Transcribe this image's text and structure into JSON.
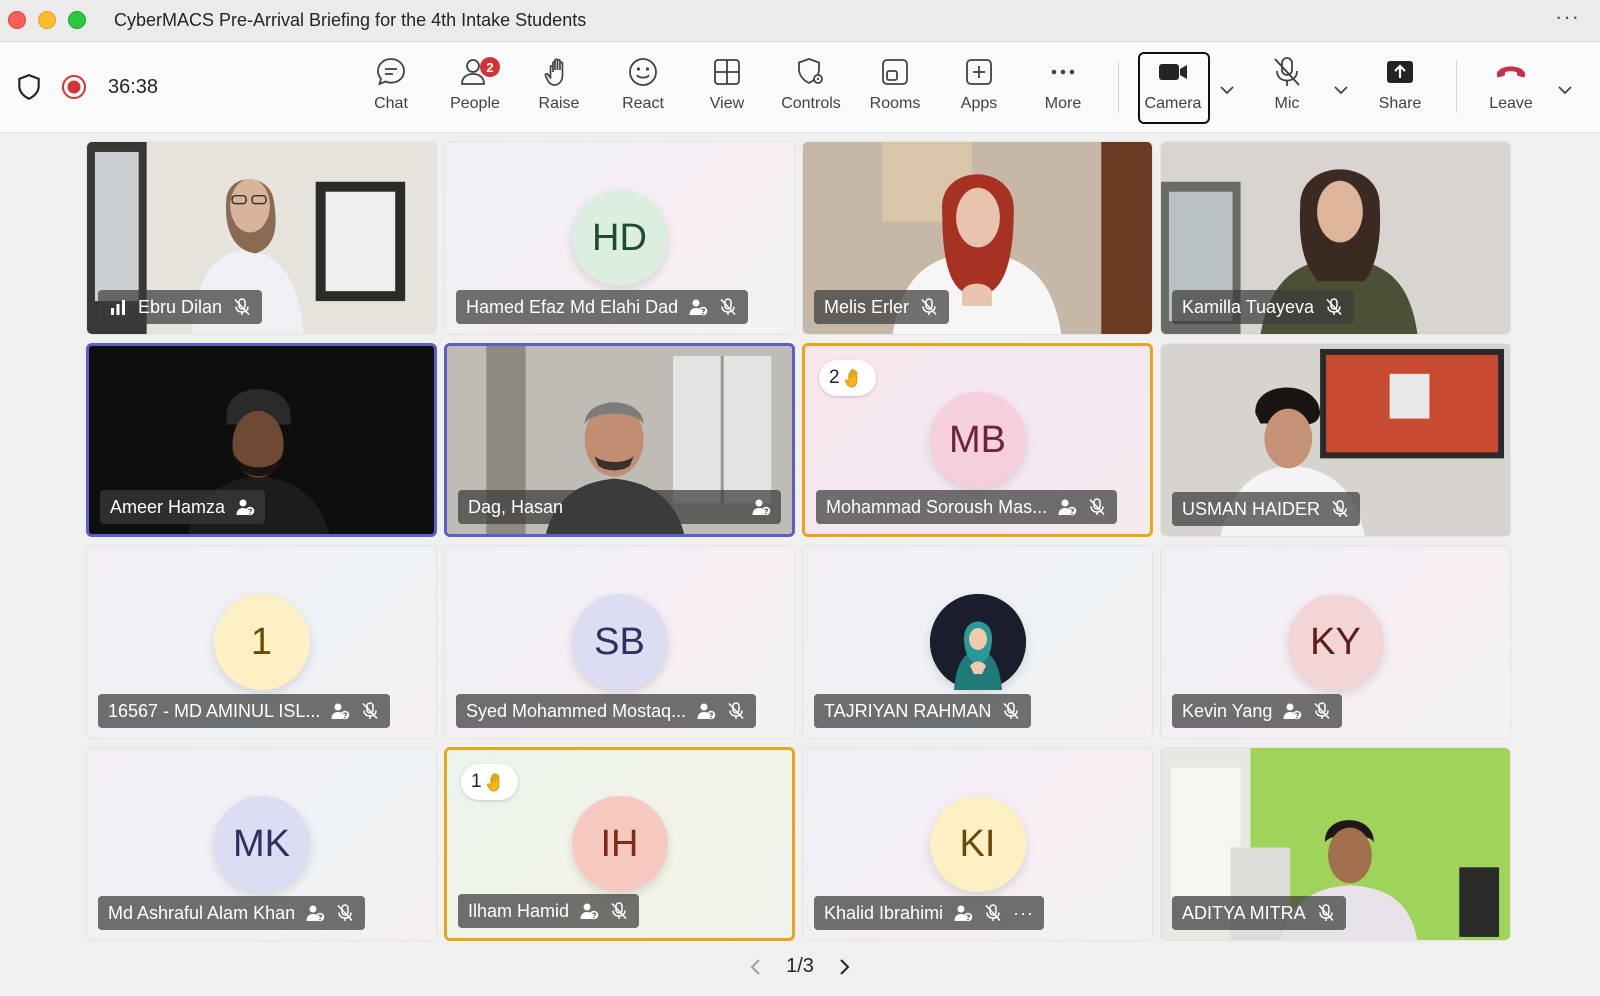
{
  "window": {
    "title": "CyberMACS Pre-Arrival Briefing for the 4th Intake Students",
    "more": "···"
  },
  "toolbar": {
    "timer": "36:38",
    "items": {
      "chat": "Chat",
      "people": "People",
      "people_badge": "2",
      "raise": "Raise",
      "react": "React",
      "view": "View",
      "controls": "Controls",
      "rooms": "Rooms",
      "apps": "Apps",
      "more": "More",
      "camera": "Camera",
      "mic": "Mic",
      "share": "Share",
      "leave": "Leave"
    },
    "colors": {
      "record": "#d13438",
      "leave": "#c4314b"
    }
  },
  "participants": [
    {
      "name": "Ebru Dilan",
      "type": "video",
      "muted": true
    },
    {
      "name": "Hamed Efaz Md Elahi Dad",
      "type": "avatar",
      "initials": "HD",
      "muted": true
    },
    {
      "name": "Melis Erler",
      "type": "video",
      "muted": true
    },
    {
      "name": "Kamilla Tuayeva",
      "type": "video",
      "muted": true
    },
    {
      "name": "Ameer Hamza",
      "type": "video",
      "speaking": true
    },
    {
      "name": "Dag, Hasan",
      "type": "video",
      "speaking": true
    },
    {
      "name": "Mohammad Soroush Mas...",
      "type": "avatar",
      "initials": "MB",
      "muted": true,
      "hand_raised": "2"
    },
    {
      "name": "USMAN HAIDER",
      "type": "video",
      "muted": true
    },
    {
      "name": "16567 - MD AMINUL ISL...",
      "type": "avatar",
      "initials": "1",
      "muted": true
    },
    {
      "name": "Syed Mohammed Mostaq...",
      "type": "avatar",
      "initials": "SB",
      "muted": true
    },
    {
      "name": "TAJRIYAN RAHMAN",
      "type": "picture",
      "muted": true
    },
    {
      "name": "Kevin Yang",
      "type": "avatar",
      "initials": "KY",
      "muted": true
    },
    {
      "name": "Md Ashraful Alam Khan",
      "type": "avatar",
      "initials": "MK",
      "muted": true
    },
    {
      "name": "Ilham Hamid",
      "type": "avatar",
      "initials": "IH",
      "muted": true,
      "hand_raised": "1"
    },
    {
      "name": "Khalid Ibrahimi",
      "type": "avatar",
      "initials": "KI",
      "muted": true
    },
    {
      "name": "ADITYA MITRA",
      "type": "video",
      "muted": true
    }
  ],
  "pagination": {
    "label": "1/3"
  }
}
